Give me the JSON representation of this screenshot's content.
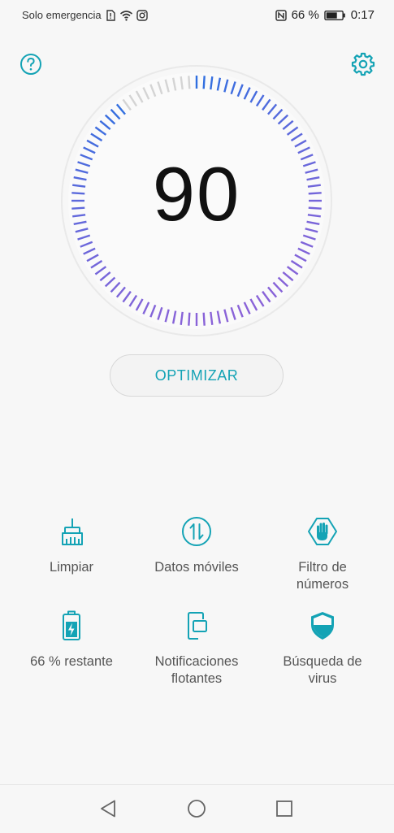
{
  "status_bar": {
    "carrier": "Solo emergencia",
    "battery_percent": "66 %",
    "time": "0:17"
  },
  "header": {
    "help_icon": "help-circle-icon",
    "settings_icon": "gear-icon"
  },
  "gauge": {
    "score": "90",
    "level": 0.9,
    "colors": {
      "start": "#2f6fe0",
      "end": "#8a63d8",
      "inactive": "#d4d4d4"
    }
  },
  "optimize_label": "OPTIMIZAR",
  "features": [
    {
      "label": "Limpiar",
      "icon": "broom-icon"
    },
    {
      "label": "Datos móviles",
      "icon": "data-transfer-icon"
    },
    {
      "label": "Filtro de\nnúmeros",
      "icon": "hand-block-icon"
    },
    {
      "label": "66 % restante",
      "icon": "battery-icon"
    },
    {
      "label": "Notificaciones\nflotantes",
      "icon": "floating-notification-icon"
    },
    {
      "label": "Búsqueda de\nvirus",
      "icon": "shield-icon"
    }
  ],
  "accent_color": "#14a3b5",
  "nav": {
    "back": "back-triangle-icon",
    "home": "home-circle-icon",
    "recents": "recents-square-icon"
  }
}
